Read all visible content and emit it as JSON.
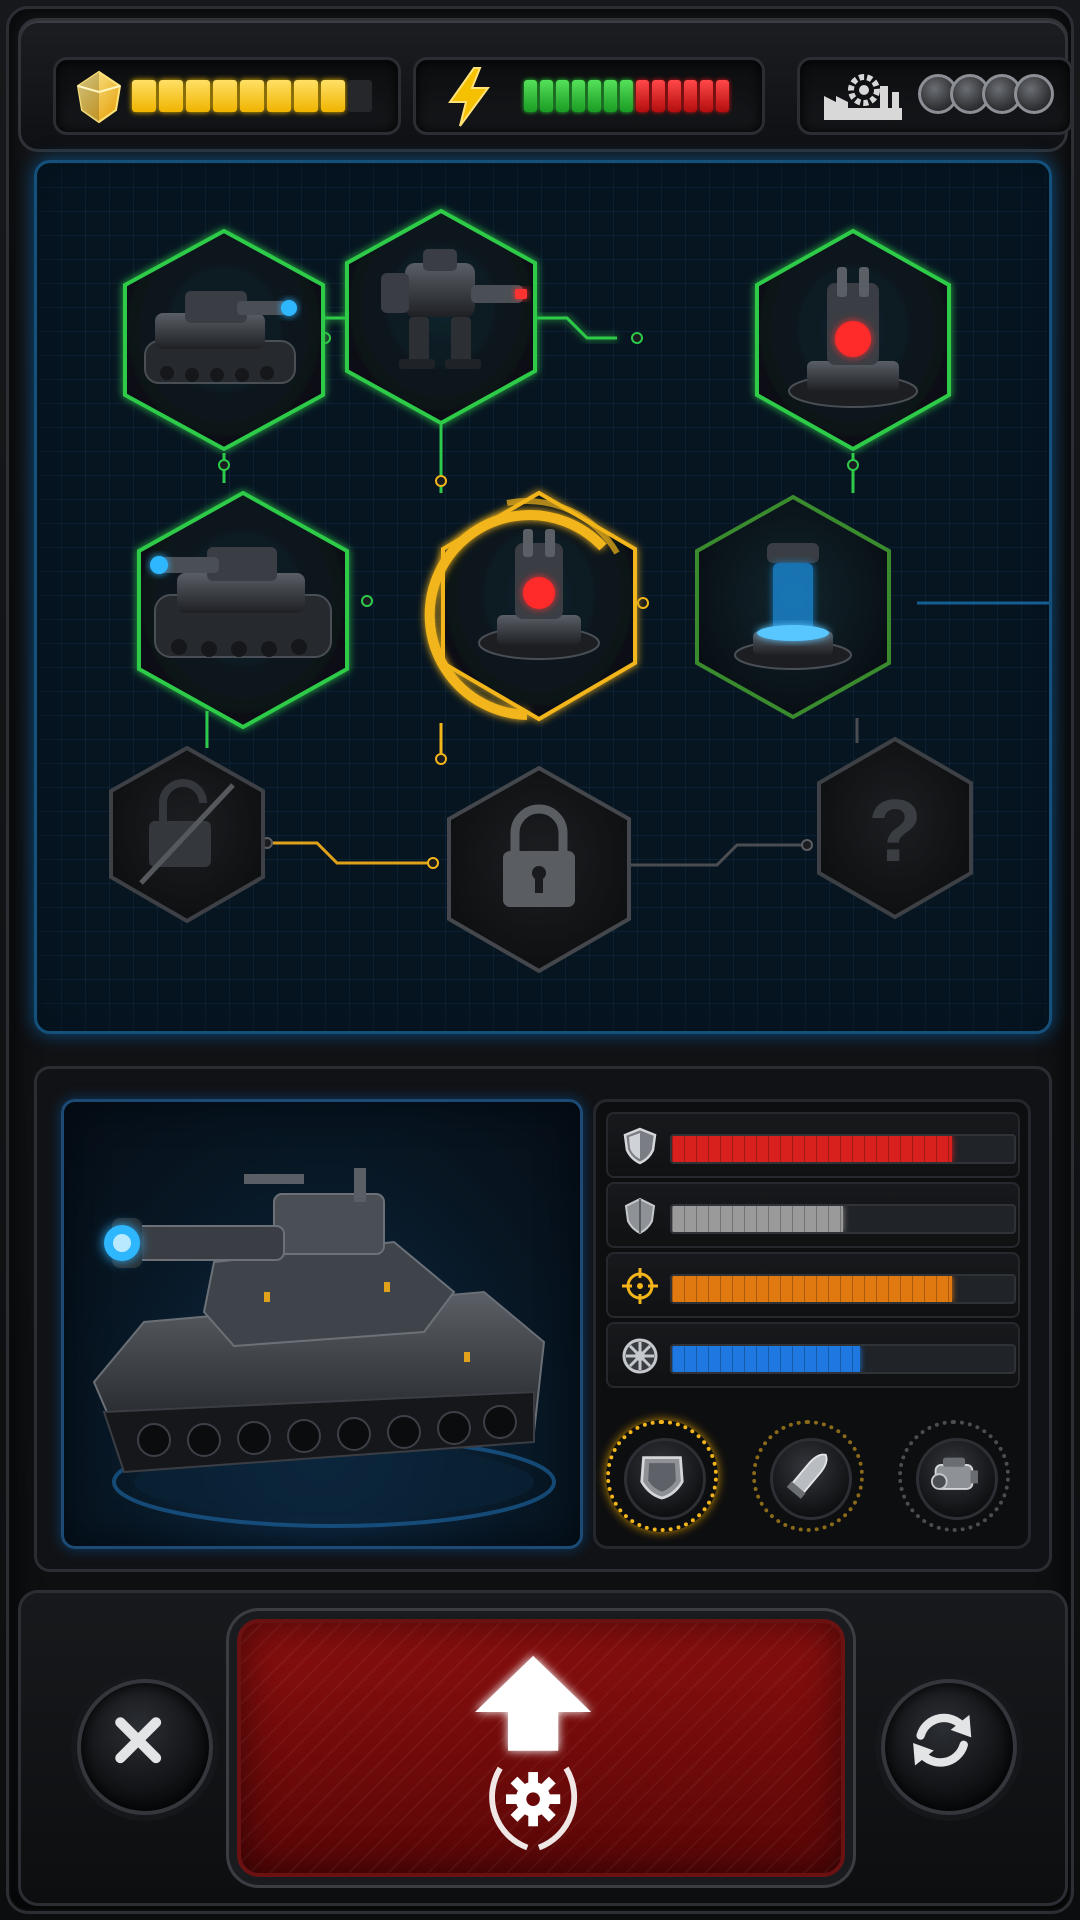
{
  "top_bar": {
    "resource1": {
      "icon": "gem-icon",
      "filled": 8,
      "total": 9,
      "color": "#f5c400"
    },
    "resource2": {
      "icon": "lightning-bolt-icon",
      "green": 7,
      "red": 6
    },
    "resource3": {
      "icon": "factory-gear-icon",
      "tokens": 4
    }
  },
  "tech_tree": {
    "nodes": [
      {
        "id": "light-tank",
        "state": "unlocked",
        "icon": "light-tank-icon"
      },
      {
        "id": "mech-walker",
        "state": "unlocked",
        "icon": "mech-walker-icon"
      },
      {
        "id": "red-reactor",
        "state": "unlocked",
        "icon": "reactor-red-icon"
      },
      {
        "id": "heavy-tank",
        "state": "unlocked",
        "icon": "heavy-tank-icon"
      },
      {
        "id": "core-reactor",
        "state": "selected",
        "icon": "reactor-core-icon"
      },
      {
        "id": "blue-teleporter",
        "state": "available",
        "icon": "teleporter-icon"
      },
      {
        "id": "broken-lock",
        "state": "disabled",
        "icon": "broken-lock-icon"
      },
      {
        "id": "locked-node",
        "state": "locked",
        "icon": "padlock-icon"
      },
      {
        "id": "unknown-node",
        "state": "unknown",
        "icon": "question-mark-icon",
        "label": "?"
      }
    ],
    "colors": {
      "unlocked": "#2ecb4a",
      "selected": "#f2b51a",
      "locked": "#4a4d52",
      "blue": "#1f8fe0"
    }
  },
  "unit_preview": {
    "unit": "heavy-tank",
    "icon": "heavy-tank-preview"
  },
  "stats": [
    {
      "icon": "armor-shield-icon",
      "value": 0.82,
      "color": "#d8211c"
    },
    {
      "icon": "defense-shield-icon",
      "value": 0.5,
      "color": "#9a9a9a"
    },
    {
      "icon": "crosshair-icon",
      "value": 0.82,
      "color": "#e07a10"
    },
    {
      "icon": "speed-wheel-icon",
      "value": 0.55,
      "color": "#1e78e0"
    }
  ],
  "modules": [
    {
      "icon": "armor-plate-icon",
      "active": true
    },
    {
      "icon": "shell-ammo-icon",
      "active": false
    },
    {
      "icon": "engine-icon",
      "active": false
    }
  ],
  "actions": {
    "cancel_icon": "close-x-icon",
    "upgrade_icon": "upgrade-arrow-gear-icon",
    "refresh_icon": "refresh-icon"
  }
}
